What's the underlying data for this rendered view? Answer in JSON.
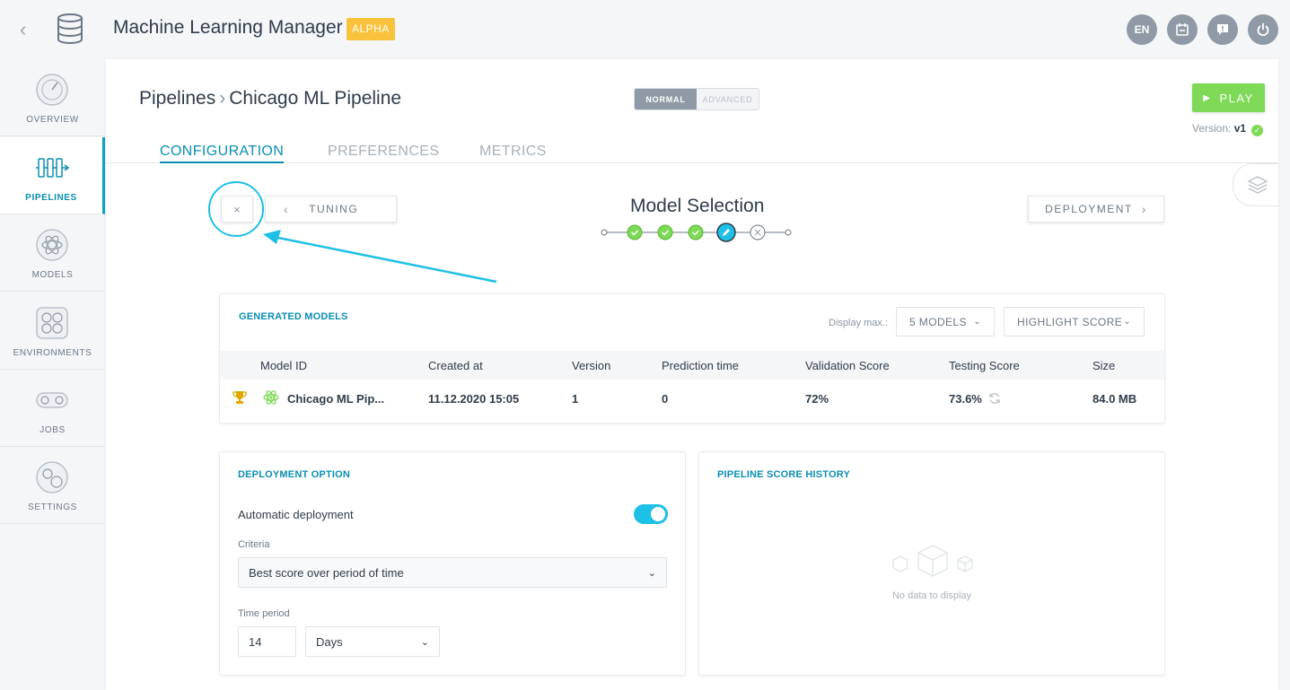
{
  "header": {
    "app_title": "Machine Learning Manager",
    "badge": "ALPHA",
    "lang": "EN"
  },
  "sidebar": {
    "items": [
      {
        "label": "OVERVIEW",
        "icon": "gauge-icon"
      },
      {
        "label": "PIPELINES",
        "icon": "pipeline-icon",
        "active": true
      },
      {
        "label": "MODELS",
        "icon": "atom-icon"
      },
      {
        "label": "ENVIRONMENTS",
        "icon": "environment-icon"
      },
      {
        "label": "JOBS",
        "icon": "jobs-icon"
      },
      {
        "label": "SETTINGS",
        "icon": "settings-icon"
      }
    ]
  },
  "breadcrumb": {
    "root": "Pipelines",
    "current": "Chicago ML Pipeline"
  },
  "mode": {
    "normal": "NORMAL",
    "advanced": "ADVANCED"
  },
  "play": {
    "label": "PLAY"
  },
  "version": {
    "label": "Version:",
    "value": "v1"
  },
  "tabs": [
    {
      "label": "CONFIGURATION",
      "active": true
    },
    {
      "label": "PREFERENCES"
    },
    {
      "label": "METRICS"
    }
  ],
  "steps": {
    "close": "×",
    "prev": "TUNING",
    "title": "Model Selection",
    "next": "DEPLOYMENT",
    "states": [
      "done",
      "done",
      "done",
      "current",
      "pending"
    ]
  },
  "generated_models": {
    "title": "GENERATED MODELS",
    "display_label": "Display max.:",
    "display_value": "5 MODELS",
    "highlight": "HIGHLIGHT SCORE",
    "columns": [
      "Model ID",
      "Created at",
      "Version",
      "Prediction time",
      "Validation Score",
      "Testing Score",
      "Size"
    ],
    "rows": [
      {
        "model_id": "Chicago ML Pip...",
        "created": "11.12.2020 15:05",
        "version": "1",
        "prediction_time": "0",
        "validation": "72%",
        "testing": "73.6%",
        "size": "84.0 MB"
      }
    ]
  },
  "deployment": {
    "title": "DEPLOYMENT OPTION",
    "auto_label": "Automatic deployment",
    "auto_on": true,
    "criteria_label": "Criteria",
    "criteria_value": "Best score over period of time",
    "period_label": "Time period",
    "period_value": "14",
    "period_unit": "Days"
  },
  "history": {
    "title": "PIPELINE SCORE HISTORY",
    "empty": "No data to display"
  },
  "colors": {
    "accent": "#0a8fb3",
    "highlight": "#1ec0e6",
    "success": "#7ed957",
    "badge": "#f9c23c"
  }
}
